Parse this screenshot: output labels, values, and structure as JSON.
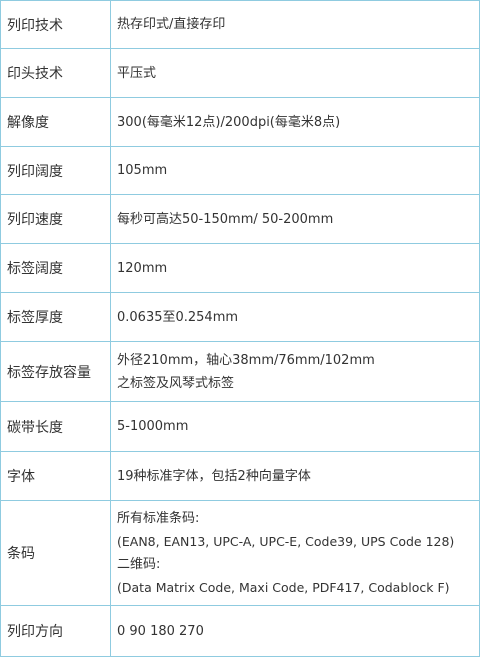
{
  "rows": [
    {
      "label": "列印技术",
      "value": "热存印式/直接存印"
    },
    {
      "label": "印头技术",
      "value": "平压式"
    },
    {
      "label": "解像度",
      "value": "300(每毫米12点)/200dpi(每毫米8点)"
    },
    {
      "label": "列印阔度",
      "value": "105mm"
    },
    {
      "label": "列印速度",
      "value": "每秒可高达50-150mm/ 50-200mm"
    },
    {
      "label": "标签阔度",
      "value": "120mm"
    },
    {
      "label": "标签厚度",
      "value": "0.0635至0.254mm"
    },
    {
      "label": "标签存放容量",
      "lines": [
        "外径210mm，轴心38mm/76mm/102mm",
        " 之标签及风琴式标签"
      ]
    },
    {
      "label": "碳带长度",
      "value": "5-1000mm"
    },
    {
      "label": "字体",
      "value": "19种标准字体，包括2种向量字体"
    },
    {
      "label": "条码",
      "lines": [
        "所有标准条码:",
        "(EAN8, EAN13, UPC-A, UPC-E, Code39, UPS Code 128)",
        " 二维码:",
        "(Data Matrix Code, Maxi Code, PDF417, Codablock F)"
      ]
    },
    {
      "label": "列印方向",
      "value": "0 90 180 270"
    }
  ]
}
